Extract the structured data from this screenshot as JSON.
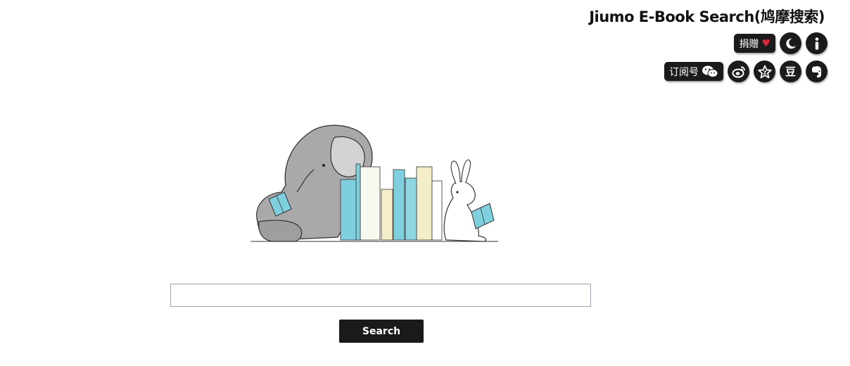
{
  "header": {
    "title": "Jiumo E-Book Search(鸠摩搜索)"
  },
  "toolbar": {
    "donate_label": "捐赠",
    "donate_icon": "heart-icon",
    "subscribe_label": "订阅号",
    "subscribe_icon": "wechat-icon",
    "night_mode_icon": "moon-icon",
    "info_icon": "info-icon",
    "weibo_icon": "weibo-icon",
    "favorite_icon": "star-icon",
    "douban_icon": "douban-icon",
    "douban_char": "豆",
    "evernote_icon": "evernote-icon"
  },
  "search": {
    "value": "",
    "placeholder": "",
    "button_label": "Search"
  },
  "colors": {
    "button_bg": "#1a1a1a",
    "heart": "#d7263d",
    "book_blue": "#7fd0de",
    "book_cream": "#f3eec8"
  }
}
